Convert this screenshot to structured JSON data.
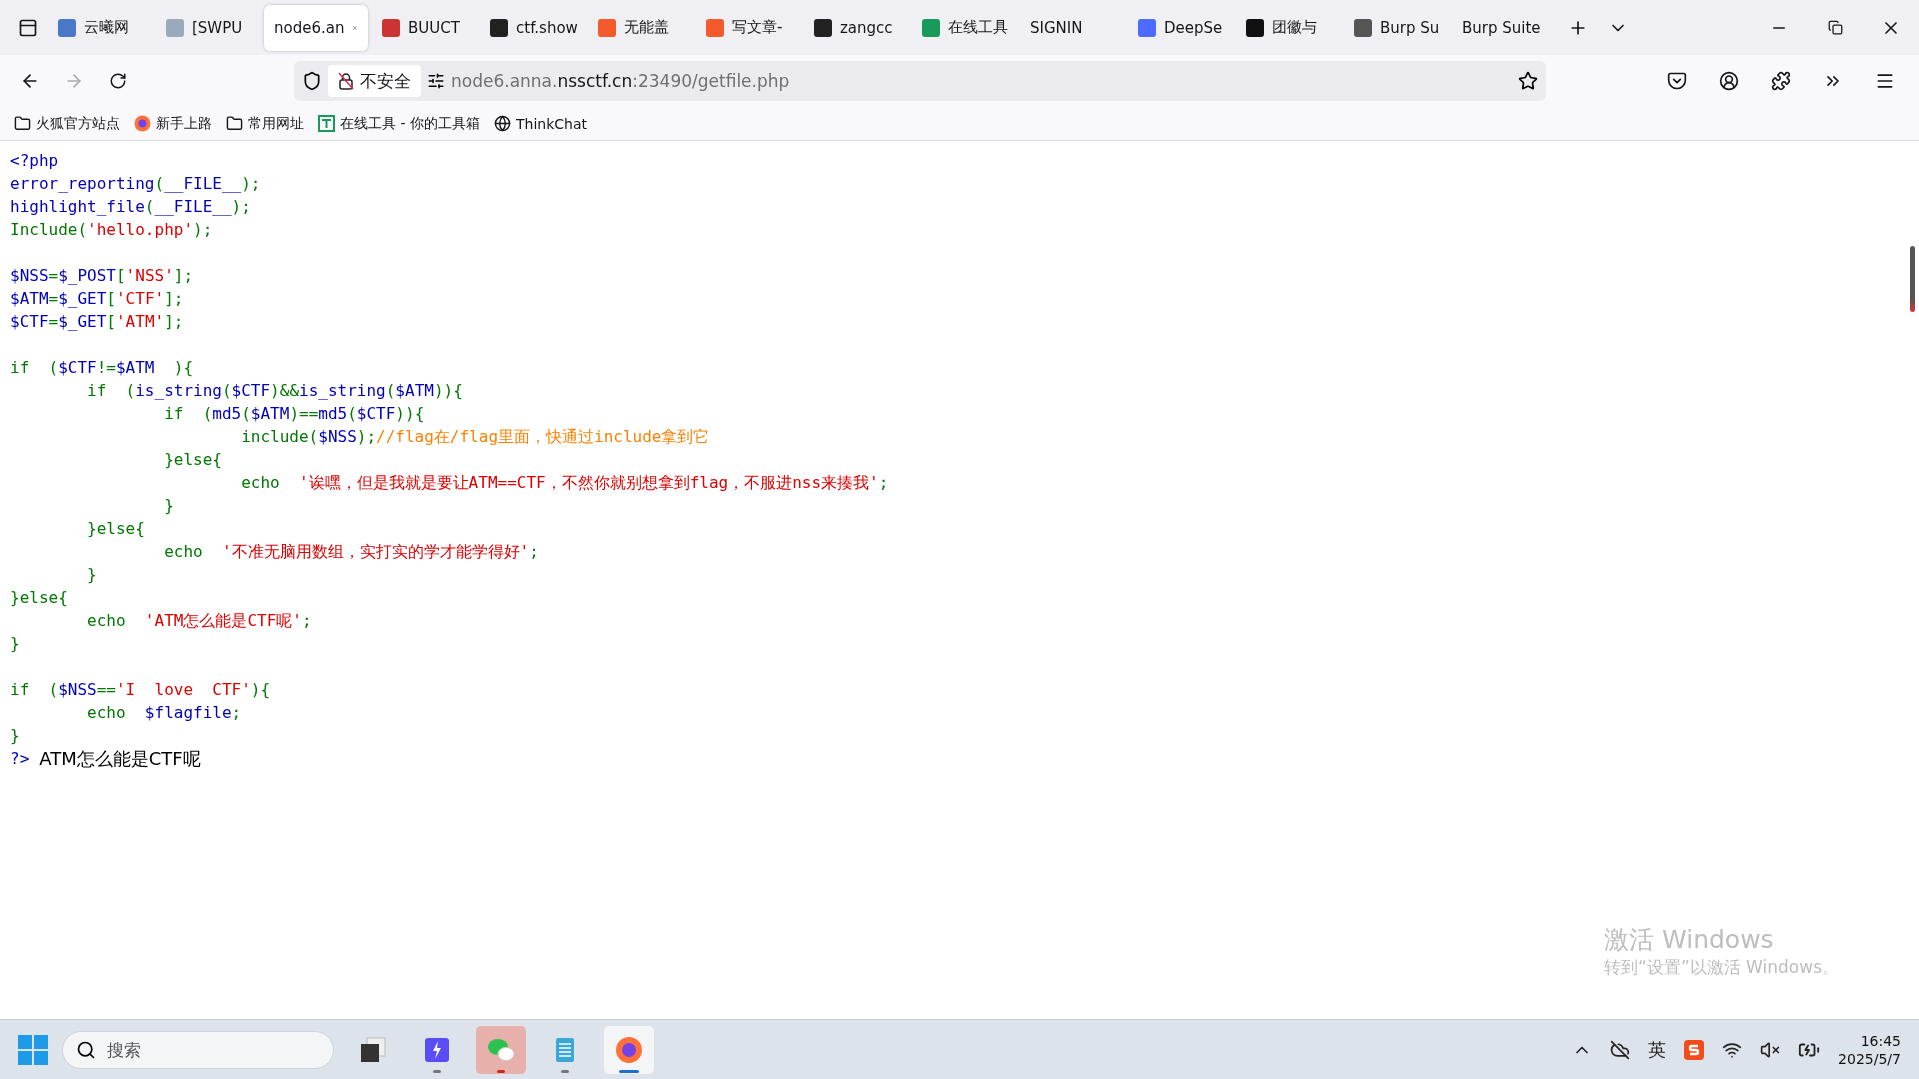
{
  "tabs": [
    {
      "label": "云曦网",
      "selected": false
    },
    {
      "label": "[SWPU",
      "selected": false
    },
    {
      "label": "node6.an",
      "selected": true
    },
    {
      "label": "BUUCT",
      "selected": false
    },
    {
      "label": "ctf.show",
      "selected": false
    },
    {
      "label": "无能盖",
      "selected": false
    },
    {
      "label": "写文章-",
      "selected": false
    },
    {
      "label": "zangcc",
      "selected": false
    },
    {
      "label": "在线工具",
      "selected": false
    },
    {
      "label": "SIGNIN",
      "selected": false
    },
    {
      "label": "DeepSe",
      "selected": false
    },
    {
      "label": "团徽与",
      "selected": false
    },
    {
      "label": "Burp Su",
      "selected": false
    },
    {
      "label": "Burp Suite",
      "selected": false
    }
  ],
  "address": {
    "security": "不安全",
    "url_start": "node6.anna.",
    "url_domain": "nssctf.cn",
    "url_end": ":23490/getfile.php"
  },
  "bookmarks": [
    {
      "kind": "folder",
      "label": "火狐官方站点"
    },
    {
      "kind": "firefox",
      "label": "新手上路"
    },
    {
      "kind": "folder",
      "label": "常用网址"
    },
    {
      "kind": "tool",
      "label": "在线工具 - 你的工具箱"
    },
    {
      "kind": "globe",
      "label": "ThinkChat"
    }
  ],
  "code": [
    {
      "tokens": [
        {
          "kind": "default",
          "text": "<?php"
        }
      ]
    },
    {
      "tokens": [
        {
          "kind": "default",
          "text": "error_reporting"
        },
        {
          "kind": "keyword",
          "text": "("
        },
        {
          "kind": "default",
          "text": "__FILE__"
        },
        {
          "kind": "keyword",
          "text": ");"
        }
      ]
    },
    {
      "tokens": [
        {
          "kind": "default",
          "text": "highlight_file"
        },
        {
          "kind": "keyword",
          "text": "("
        },
        {
          "kind": "default",
          "text": "__FILE__"
        },
        {
          "kind": "keyword",
          "text": ");"
        }
      ]
    },
    {
      "tokens": [
        {
          "kind": "keyword",
          "text": "Include("
        },
        {
          "kind": "string",
          "text": "'hello.php'"
        },
        {
          "kind": "keyword",
          "text": ");"
        }
      ]
    },
    {
      "gap_before": true,
      "tokens": [
        {
          "kind": "default",
          "text": "$NSS"
        },
        {
          "kind": "keyword",
          "text": "="
        },
        {
          "kind": "default",
          "text": "$_POST"
        },
        {
          "kind": "keyword",
          "text": "["
        },
        {
          "kind": "string",
          "text": "'NSS'"
        },
        {
          "kind": "keyword",
          "text": "];"
        }
      ]
    },
    {
      "tokens": [
        {
          "kind": "default",
          "text": "$ATM"
        },
        {
          "kind": "keyword",
          "text": "="
        },
        {
          "kind": "default",
          "text": "$_GET"
        },
        {
          "kind": "keyword",
          "text": "["
        },
        {
          "kind": "string",
          "text": "'CTF'"
        },
        {
          "kind": "keyword",
          "text": "];"
        }
      ]
    },
    {
      "tokens": [
        {
          "kind": "default",
          "text": "$CTF"
        },
        {
          "kind": "keyword",
          "text": "="
        },
        {
          "kind": "default",
          "text": "$_GET"
        },
        {
          "kind": "keyword",
          "text": "["
        },
        {
          "kind": "string",
          "text": "'ATM'"
        },
        {
          "kind": "keyword",
          "text": "];"
        }
      ]
    },
    {
      "gap_before": true,
      "tokens": [
        {
          "kind": "keyword",
          "text": "if  ("
        },
        {
          "kind": "default",
          "text": "$CTF"
        },
        {
          "kind": "keyword",
          "text": "!="
        },
        {
          "kind": "default",
          "text": "$ATM  "
        },
        {
          "kind": "keyword",
          "text": "){"
        }
      ]
    },
    {
      "tokens": [
        {
          "kind": "keyword",
          "text": "\tif  ("
        },
        {
          "kind": "default",
          "text": "is_string"
        },
        {
          "kind": "keyword",
          "text": "("
        },
        {
          "kind": "default",
          "text": "$CTF"
        },
        {
          "kind": "keyword",
          "text": ")&&"
        },
        {
          "kind": "default",
          "text": "is_string"
        },
        {
          "kind": "keyword",
          "text": "("
        },
        {
          "kind": "default",
          "text": "$ATM"
        },
        {
          "kind": "keyword",
          "text": ")){"
        }
      ]
    },
    {
      "tokens": [
        {
          "kind": "keyword",
          "text": "\t\tif  ("
        },
        {
          "kind": "default",
          "text": "md5"
        },
        {
          "kind": "keyword",
          "text": "("
        },
        {
          "kind": "default",
          "text": "$ATM"
        },
        {
          "kind": "keyword",
          "text": ")=="
        },
        {
          "kind": "default",
          "text": "md5"
        },
        {
          "kind": "keyword",
          "text": "("
        },
        {
          "kind": "default",
          "text": "$CTF"
        },
        {
          "kind": "keyword",
          "text": ")){"
        }
      ]
    },
    {
      "tokens": [
        {
          "kind": "keyword",
          "text": "\t\t\tinclude("
        },
        {
          "kind": "default",
          "text": "$NSS"
        },
        {
          "kind": "keyword",
          "text": ");"
        },
        {
          "kind": "comment",
          "text": "//flag在/flag里面，快通过include拿到它"
        }
      ]
    },
    {
      "tokens": [
        {
          "kind": "keyword",
          "text": "\t\t}else{"
        }
      ]
    },
    {
      "tokens": [
        {
          "kind": "keyword",
          "text": "\t\t\techo  "
        },
        {
          "kind": "string",
          "text": "'诶嘿，但是我就是要让ATM==CTF，不然你就别想拿到flag，不服进nss来揍我'"
        },
        {
          "kind": "keyword",
          "text": ";"
        }
      ]
    },
    {
      "tokens": [
        {
          "kind": "keyword",
          "text": "\t\t}"
        }
      ]
    },
    {
      "tokens": [
        {
          "kind": "keyword",
          "text": "\t}else{"
        }
      ]
    },
    {
      "tokens": [
        {
          "kind": "keyword",
          "text": "\t\techo  "
        },
        {
          "kind": "string",
          "text": "'不准无脑用数组，实打实的学才能学得好'"
        },
        {
          "kind": "keyword",
          "text": ";"
        }
      ]
    },
    {
      "tokens": [
        {
          "kind": "keyword",
          "text": "\t}"
        }
      ]
    },
    {
      "tokens": [
        {
          "kind": "keyword",
          "text": "}else{"
        }
      ]
    },
    {
      "tokens": [
        {
          "kind": "keyword",
          "text": "\techo  "
        },
        {
          "kind": "string",
          "text": "'ATM怎么能是CTF呢'"
        },
        {
          "kind": "keyword",
          "text": ";"
        }
      ]
    },
    {
      "tokens": [
        {
          "kind": "keyword",
          "text": "}"
        }
      ]
    },
    {
      "gap_before": true,
      "tokens": [
        {
          "kind": "keyword",
          "text": "if  ("
        },
        {
          "kind": "default",
          "text": "$NSS"
        },
        {
          "kind": "keyword",
          "text": "=="
        },
        {
          "kind": "string",
          "text": "'I  love  CTF'"
        },
        {
          "kind": "keyword",
          "text": "){"
        }
      ]
    },
    {
      "tokens": [
        {
          "kind": "keyword",
          "text": "\techo  "
        },
        {
          "kind": "default",
          "text": "$flagfile"
        },
        {
          "kind": "keyword",
          "text": ";"
        }
      ]
    },
    {
      "tokens": [
        {
          "kind": "keyword",
          "text": "}"
        }
      ]
    },
    {
      "tokens": [
        {
          "kind": "default",
          "text": "?>"
        }
      ]
    }
  ],
  "output": "ATM怎么能是CTF呢",
  "activation": {
    "title": "激活 Windows",
    "hint": "转到“设置”以激活 Windows。"
  },
  "taskbar": {
    "search_placeholder": "搜索",
    "apps": [
      {
        "kind": "taskview",
        "selected": false,
        "running": false,
        "alert": false
      },
      {
        "kind": "bolt",
        "selected": false,
        "running": true,
        "alert": false
      },
      {
        "kind": "chat",
        "selected": false,
        "running": true,
        "alert": true
      },
      {
        "kind": "notepad",
        "selected": false,
        "running": true,
        "alert": false
      },
      {
        "kind": "firefox",
        "selected": true,
        "running": true,
        "alert": false
      }
    ],
    "ime": "英",
    "time": "16:45",
    "date": "2025/5/7"
  }
}
